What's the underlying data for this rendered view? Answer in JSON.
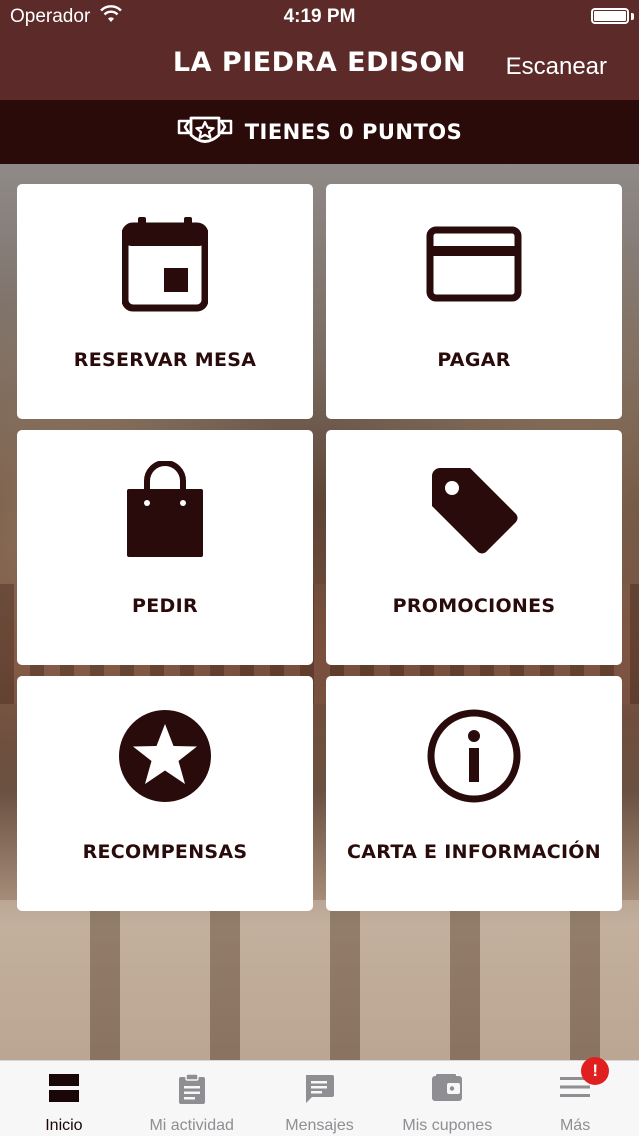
{
  "status_bar": {
    "carrier": "Operador",
    "time": "4:19 PM"
  },
  "header": {
    "title": "LA PIEDRA EDISON",
    "scan_label": "Escanear"
  },
  "points": {
    "text": "TIENES 0 PUNTOS",
    "icon": "badge-star-icon"
  },
  "tiles": [
    {
      "label": "RESERVAR MESA",
      "icon": "calendar-icon"
    },
    {
      "label": "PAGAR",
      "icon": "credit-card-icon"
    },
    {
      "label": "PEDIR",
      "icon": "shopping-bag-icon"
    },
    {
      "label": "PROMOCIONES",
      "icon": "tag-icon"
    },
    {
      "label": "RECOMPENSAS",
      "icon": "star-circle-icon"
    },
    {
      "label": "CARTA E INFORMACIÓN",
      "icon": "info-icon"
    }
  ],
  "tabbar": {
    "items": [
      {
        "label": "Inicio",
        "icon": "home-grid-icon",
        "active": true
      },
      {
        "label": "Mi actividad",
        "icon": "clipboard-icon",
        "active": false
      },
      {
        "label": "Mensajes",
        "icon": "message-icon",
        "active": false
      },
      {
        "label": "Mis cupones",
        "icon": "wallet-icon",
        "active": false
      },
      {
        "label": "Más",
        "icon": "menu-icon",
        "active": false,
        "badge": "!"
      }
    ]
  },
  "colors": {
    "header": "#5b2a29",
    "points_bar": "#2b0a0a",
    "icon": "#2a0b0b",
    "badge": "#e02020"
  }
}
